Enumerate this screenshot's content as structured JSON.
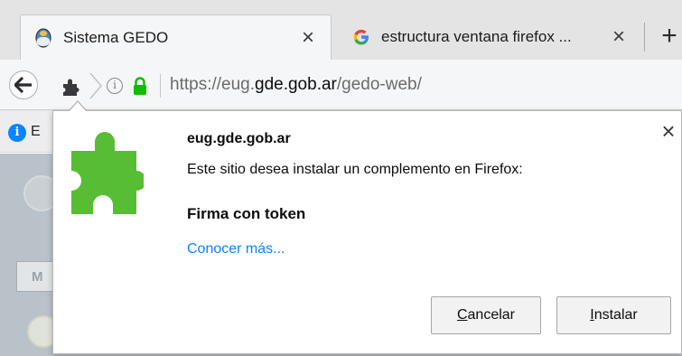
{
  "window": {
    "tabs": [
      {
        "title": "Sistema GEDO",
        "favicon": "shield-crest-icon",
        "active": true
      },
      {
        "title": "estructura ventana firefox ...",
        "favicon": "google-g-icon",
        "active": false
      }
    ],
    "new_tab_glyph": "+"
  },
  "navbar": {
    "url_scheme": "https://",
    "url_sub": "eug.",
    "url_host": "gde.gob.ar",
    "url_path": "/gedo-web/"
  },
  "page": {
    "infobar_text": "E",
    "tab_label": "M"
  },
  "doorhanger": {
    "host": "eug.gde.gob.ar",
    "message": "Este sitio desea instalar un complemento en Firefox:",
    "addon_name": "Firma con token",
    "learn_more": "Conocer más...",
    "cancel": {
      "accesskey": "C",
      "rest": "ancelar"
    },
    "install": {
      "accesskey": "I",
      "rest": "nstalar"
    },
    "icon": "puzzle-piece-icon",
    "icon_color": "#57bd35"
  },
  "colors": {
    "link": "#0a84ff",
    "lock": "#12bc00",
    "info_blue": "#0a84ff"
  }
}
